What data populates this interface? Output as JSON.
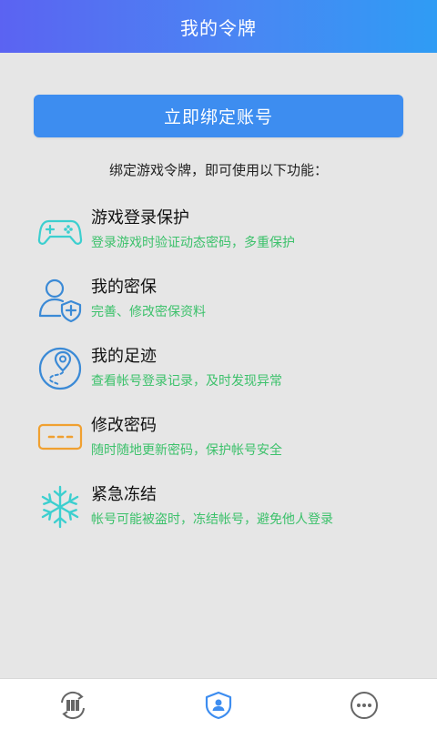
{
  "header": {
    "title": "我的令牌"
  },
  "bind_button": {
    "label": "立即绑定账号"
  },
  "intro": "绑定游戏令牌，即可使用以下功能：",
  "features": [
    {
      "title": "游戏登录保护",
      "desc": "登录游戏时验证动态密码，多重保护",
      "icon": "gamepad-icon"
    },
    {
      "title": "我的密保",
      "desc": "完善、修改密保资料",
      "icon": "user-shield-icon"
    },
    {
      "title": "我的足迹",
      "desc": "查看帐号登录记录，及时发现异常",
      "icon": "location-pin-icon"
    },
    {
      "title": "修改密码",
      "desc": "随时随地更新密码，保护帐号安全",
      "icon": "password-field-icon"
    },
    {
      "title": "紧急冻结",
      "desc": "帐号可能被盗时，冻结帐号，避免他人登录",
      "icon": "snowflake-icon"
    }
  ],
  "tabs": [
    {
      "icon": "card-exchange-icon"
    },
    {
      "icon": "shield-user-icon",
      "active": true
    },
    {
      "icon": "more-dots-icon"
    }
  ],
  "colors": {
    "header_start": "#5b63f2",
    "header_end": "#2f9cf4",
    "button": "#3d8df0",
    "desc_green": "#3cc16b",
    "icon_teal": "#3ccfcf",
    "icon_blue": "#3b8ad6",
    "icon_orange": "#f0a030"
  }
}
